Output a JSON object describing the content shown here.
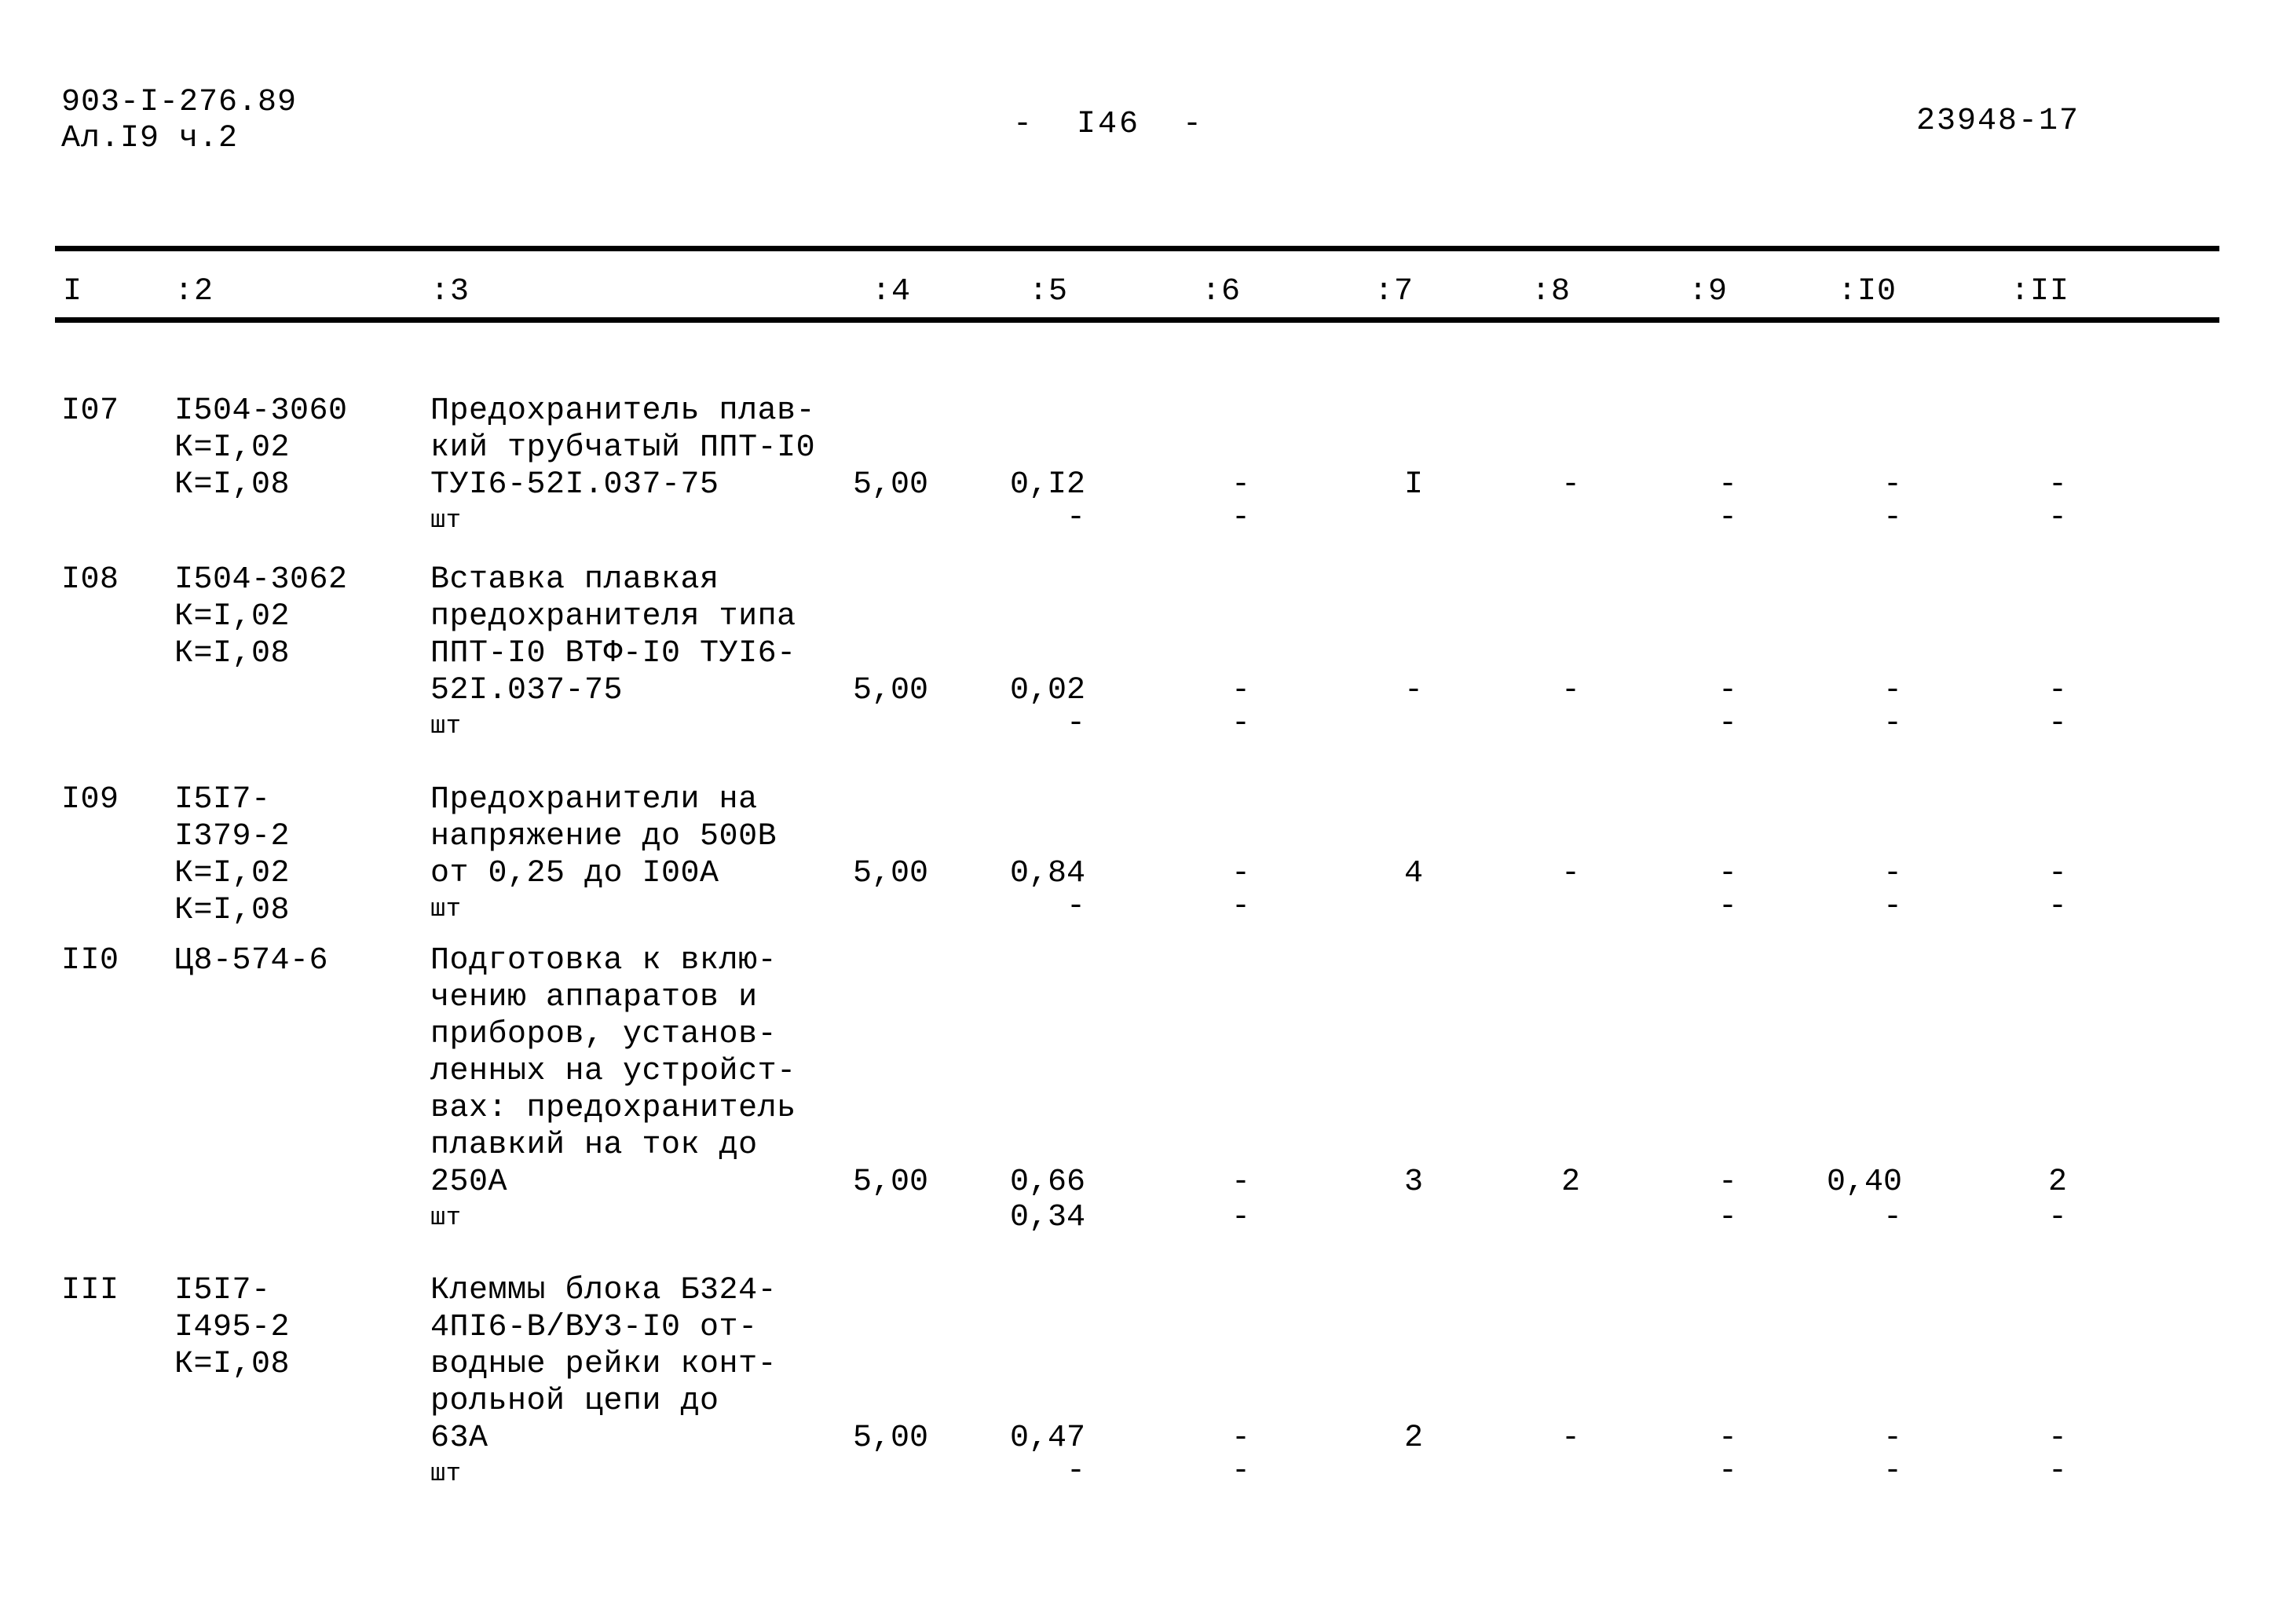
{
  "header": {
    "doc_code_line1": "903-I-276.89",
    "doc_code_line2": "Ал.I9 ч.2",
    "page_number": "-  I46  -",
    "stamp_number": "23948-17"
  },
  "table": {
    "columns": [
      "I",
      ":2",
      ":3",
      ":4",
      ":5",
      ":6",
      ":7",
      ":8",
      ":9",
      ":I0",
      ":II"
    ],
    "rows": [
      {
        "num": "I07",
        "code": "I504-3060\nК=I,02\nК=I,08",
        "description": "Предохранитель плав-\nкий трубчатый ППТ-I0\nТУI6-52I.037-75",
        "unit": "шт",
        "c4": "5,00",
        "c5": "0,I2",
        "c5b": "-",
        "c6": "-",
        "c6b": "-",
        "c7": "I",
        "c7b": "",
        "c8": "-",
        "c8b": "",
        "c9": "-",
        "c9b": "-",
        "c10": "-",
        "c10b": "-",
        "c11": "-",
        "c11b": "-"
      },
      {
        "num": "I08",
        "code": "I504-3062\nК=I,02\nК=I,08",
        "description": "Вставка плавкая\nпредохранителя типа\nППТ-I0 ВТФ-I0 ТУI6-\n52I.037-75",
        "unit": "шт",
        "c4": "5,00",
        "c5": "0,02",
        "c5b": "-",
        "c6": "-",
        "c6b": "-",
        "c7": "-",
        "c7b": "",
        "c8": "-",
        "c8b": "",
        "c9": "-",
        "c9b": "-",
        "c10": "-",
        "c10b": "-",
        "c11": "-",
        "c11b": "-"
      },
      {
        "num": "I09",
        "code": "I5I7-\nI379-2\nК=I,02\nК=I,08",
        "description": "Предохранители на\nнапряжение до 500В\nот 0,25 до I00A",
        "unit": "шт",
        "c4": "5,00",
        "c5": "0,84",
        "c5b": "-",
        "c6": "-",
        "c6b": "-",
        "c7": "4",
        "c7b": "",
        "c8": "-",
        "c8b": "",
        "c9": "-",
        "c9b": "-",
        "c10": "-",
        "c10b": "-",
        "c11": "-",
        "c11b": "-"
      },
      {
        "num": "II0",
        "code": "Ц8-574-6",
        "description": "Подготовка к вклю-\nчению аппаратов и\nприборов, установ-\nленных на устройст-\nвах: предохранитель\nплавкий на ток до\n250А",
        "unit": "шт",
        "c4": "5,00",
        "c5": "0,66",
        "c5b": "0,34",
        "c6": "-",
        "c6b": "-",
        "c7": "3",
        "c7b": "",
        "c8": "2",
        "c8b": "",
        "c9": "-",
        "c9b": "-",
        "c10": "0,40",
        "c10b": "-",
        "c11": "2",
        "c11b": "-"
      },
      {
        "num": "III",
        "code": "I5I7-\nI495-2\nК=I,08",
        "description": "Клеммы блока Б324-\n4ПI6-В/ВУ3-I0 от-\nводные рейки конт-\nрольной цепи до\n63А",
        "unit": "шт",
        "c4": "5,00",
        "c5": "0,47",
        "c5b": "-",
        "c6": "-",
        "c6b": "-",
        "c7": "2",
        "c7b": "",
        "c8": "-",
        "c8b": "",
        "c9": "-",
        "c9b": "-",
        "c10": "-",
        "c10b": "-",
        "c11": "-",
        "c11b": "-"
      }
    ]
  }
}
